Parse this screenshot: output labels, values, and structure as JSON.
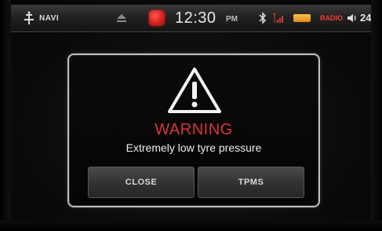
{
  "status_bar": {
    "navi_label": "NAVI",
    "time": "12:30",
    "ampm": "PM",
    "radio_label": "RADIO",
    "volume": "24",
    "icons": [
      "navi-icon",
      "eject-icon",
      "warning-tile-icon",
      "bluetooth-icon",
      "signal-icon",
      "battery-icon",
      "speaker-icon"
    ],
    "colors": {
      "radio": "#ff3b2f",
      "warning_tile": "#d6201a",
      "battery": "#e08a16"
    }
  },
  "dialog": {
    "icon": "warning-triangle-icon",
    "title": "WARNING",
    "message": "Extremely low tyre pressure",
    "buttons": {
      "close": "CLOSE",
      "tpms": "TPMS"
    },
    "colors": {
      "title": "#e0342b",
      "border": "#bdbdbd"
    }
  }
}
